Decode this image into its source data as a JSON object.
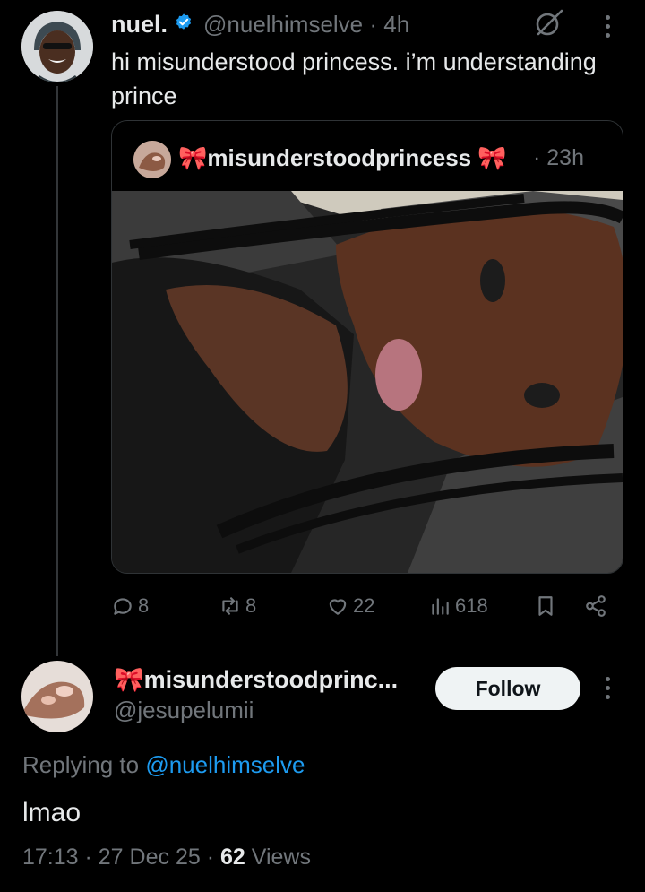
{
  "tweet": {
    "author_name": "nuel.",
    "handle": "@nuelhimselve",
    "time": "· 4h",
    "text": "hi misunderstood princess. i’m understanding prince",
    "quote": {
      "author_name": "🎀misunderstoodprincess 🎀",
      "time": "· 23h"
    },
    "actions": {
      "replies": "8",
      "reposts": "8",
      "likes": "22",
      "views": "618"
    }
  },
  "reply": {
    "author_name": "🎀misunderstoodprinc...",
    "handle": "@jesupelumii",
    "follow_label": "Follow",
    "replying_prefix": "Replying to",
    "replying_handle": "@nuelhimselve",
    "text": "lmao",
    "time": "17:13",
    "date": "27 Dec 25",
    "views_count": "62",
    "views_label": "Views"
  },
  "colors": {
    "background": "#000000",
    "text_primary": "#e7e9ea",
    "text_secondary": "#71767b",
    "link": "#1d9bf0",
    "verified": "#1d9bf0"
  }
}
